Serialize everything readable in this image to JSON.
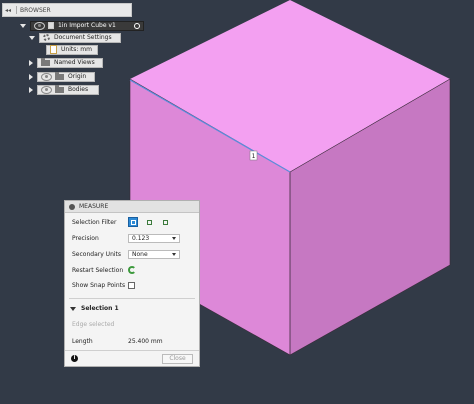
{
  "browser": {
    "title": "BROWSER",
    "collapse_glyph": "◂◂",
    "nodes": {
      "root": "1in Import Cube v1",
      "document_settings": "Document Settings",
      "units": "Units: mm",
      "named_views": "Named Views",
      "origin": "Origin",
      "bodies": "Bodies"
    }
  },
  "viewport": {
    "colors": {
      "background": "#323a47",
      "cube_top": "#f3a0f1",
      "cube_left": "#dd88d8",
      "cube_right": "#c678c2",
      "selected_edge": "#5b8ddb"
    },
    "edge_label": "1"
  },
  "measure": {
    "title": "MEASURE",
    "selection_filter_label": "Selection Filter",
    "precision_label": "Precision",
    "precision_value": "0.123",
    "secondary_units_label": "Secondary Units",
    "secondary_units_value": "None",
    "restart_selection_label": "Restart Selection",
    "show_snap_points_label": "Show Snap Points",
    "selection_header": "Selection 1",
    "selection_status": "Edge selected",
    "length_label": "Length",
    "length_value": "25.400 mm",
    "close_label": "Close",
    "info_glyph": "i"
  }
}
